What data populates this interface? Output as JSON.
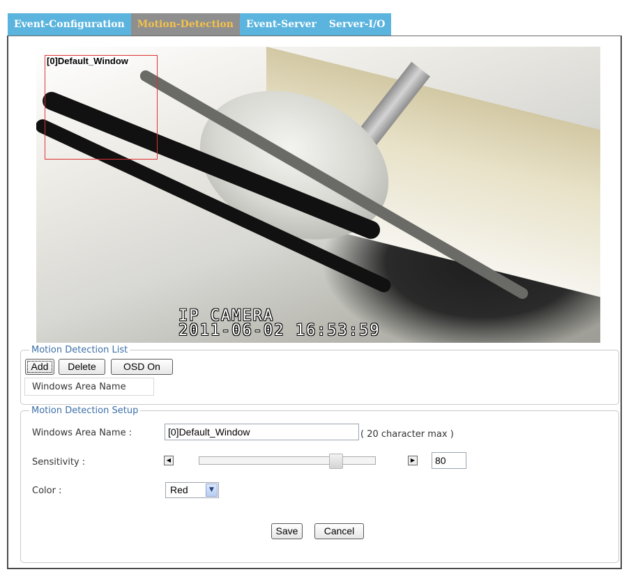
{
  "tabs": [
    {
      "label": "Event-Configuration",
      "active": false
    },
    {
      "label": "Motion-Detection",
      "active": true
    },
    {
      "label": "Event-Server",
      "active": false
    },
    {
      "label": "Server-I/O",
      "active": false
    }
  ],
  "video": {
    "window_label": "[0]Default_Window",
    "osd_line1": "IP CAMERA",
    "osd_line2": "2011-06-02 16:53:59",
    "window_color": "#dd3333"
  },
  "list": {
    "legend": "Motion Detection List",
    "add_label": "Add",
    "delete_label": "Delete",
    "osd_label": "OSD On",
    "column_header": "Windows Area Name"
  },
  "setup": {
    "legend": "Motion Detection Setup",
    "name_label": "Windows Area Name :",
    "name_value": "[0]Default_Window",
    "name_hint": "( 20 character max )",
    "sensitivity_label": "Sensitivity :",
    "sensitivity_value": "80",
    "sensitivity_fraction": 0.8,
    "color_label": "Color :",
    "color_value": "Red",
    "save_label": "Save",
    "cancel_label": "Cancel"
  },
  "colors": {
    "tab_bg": "#5ab4de",
    "tab_active_bg": "#8f8f8f",
    "tab_active_text": "#f4c24a",
    "legend_text": "#3d6fa8"
  },
  "icons": {
    "slider_left": "triangle-left-icon",
    "slider_right": "triangle-right-icon",
    "dropdown": "chevron-down-icon"
  }
}
